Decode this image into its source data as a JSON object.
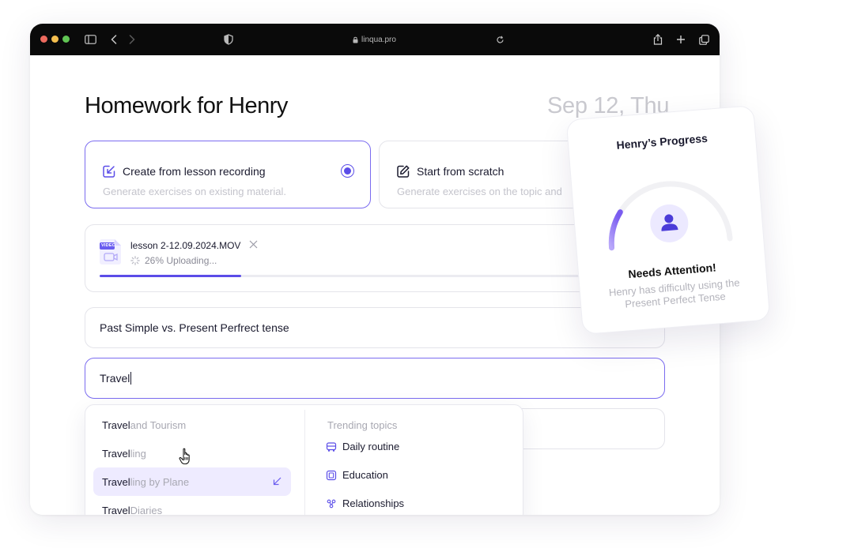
{
  "browser": {
    "url": "linqua.pro"
  },
  "page": {
    "title": "Homework for Henry",
    "date": "Sep 12, Thu"
  },
  "options": [
    {
      "title": "Create from lesson recording",
      "subtitle": "Generate exercises on existing material.",
      "selected": true
    },
    {
      "title": "Start from scratch",
      "subtitle": "Generate exercises on the topic and",
      "selected": false
    }
  ],
  "upload": {
    "file_badge": "VIDEO",
    "file_name": "lesson 2-12.09.2024.MOV",
    "status": "26% Uploading...",
    "progress": 0.26
  },
  "fields": {
    "topic_value": "Past Simple vs. Present Perfrect tense",
    "search_value": "Travel"
  },
  "suggestions": [
    {
      "bold": "Travel",
      "light": " and Tourism",
      "active": false
    },
    {
      "bold": "Travel",
      "light": "ling",
      "active": false
    },
    {
      "bold": "Travel",
      "light": "ling by Plane",
      "active": true
    },
    {
      "bold": "Travel",
      "light": " Diaries",
      "active": false
    }
  ],
  "trending": {
    "heading": "Trending topics",
    "items": [
      {
        "label": "Daily routine",
        "icon": "bus-icon"
      },
      {
        "label": "Education",
        "icon": "book-icon"
      },
      {
        "label": "Relationships",
        "icon": "people-icon"
      }
    ]
  },
  "progress_card": {
    "title": "Henry’s Progress",
    "headline": "Needs Attention!",
    "description": "Henry has difficulty using the Present Perfect Tense",
    "gauge_level": 0.2,
    "accent": "#8b6cf2"
  },
  "colors": {
    "accent": "#5b4de8",
    "accent_border": "#7b6cf0",
    "highlight": "#eeebff"
  }
}
